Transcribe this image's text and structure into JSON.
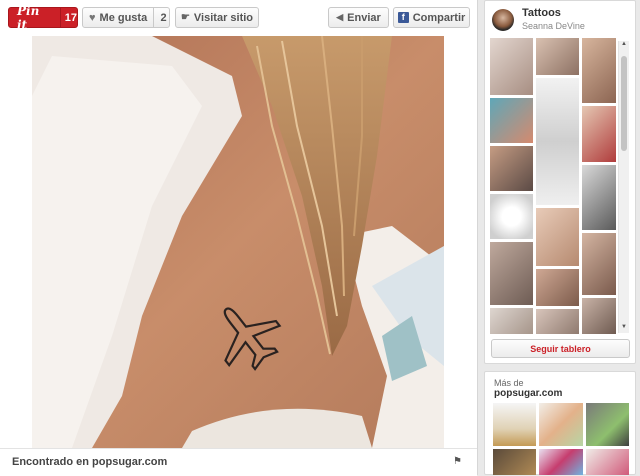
{
  "toolbar": {
    "pin_label": "Pin it",
    "pin_count": "17",
    "like_label": "Me gusta",
    "like_count": "2",
    "visit_label": "Visitar sitio",
    "send_label": "Enviar",
    "share_label": "Compartir"
  },
  "footer": {
    "found_text": "Encontrado en popsugar.com"
  },
  "board": {
    "title": "Tattoos",
    "owner": "Seanna DeVine",
    "follow_label": "Seguir tablero"
  },
  "more_from": {
    "label": "Más de",
    "site": "popsugar.com"
  },
  "colors": {
    "pin_red": "#cb2027",
    "facebook_blue": "#3b5998"
  }
}
